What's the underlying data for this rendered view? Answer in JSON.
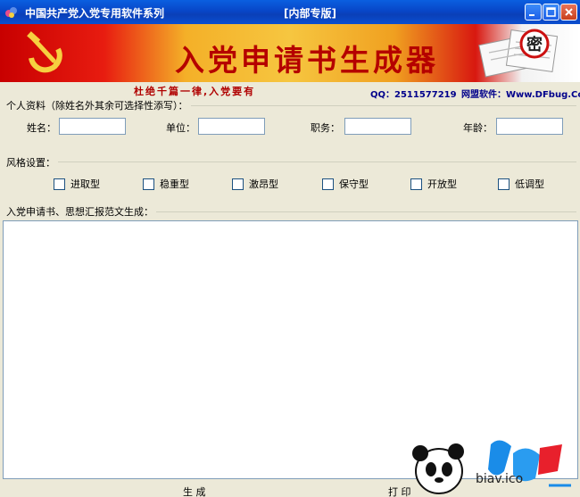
{
  "window": {
    "title": "中国共产党入党专用软件系列",
    "title_mid": "[内部专版]"
  },
  "banner": {
    "title": "入党申请书生成器",
    "stamp": "密"
  },
  "subheader": {
    "slogan": "杜绝千篇一律,入党要有",
    "qq": "QQ：2511577219",
    "web": "网盟软件：Www.DFbug.Com"
  },
  "personal": {
    "group_label": "个人资料（除姓名外其余可选择性添写）：",
    "name_label": "姓名：",
    "unit_label": "单位：",
    "position_label": "职务：",
    "age_label": "年龄：",
    "name_value": "",
    "unit_value": "",
    "position_value": "",
    "age_value": ""
  },
  "style": {
    "group_label": "风格设置：",
    "options": [
      "进取型",
      "稳重型",
      "激昂型",
      "保守型",
      "开放型",
      "低调型"
    ]
  },
  "output": {
    "group_label": "入党申请书、思想汇报范文生成：",
    "value": ""
  },
  "actions": {
    "generate_label": "生 成",
    "print_label": "打 印"
  },
  "watermark": {
    "text": "biav.ico"
  },
  "colors": {
    "titlebar": "#0846c8",
    "banner_red": "#c80000",
    "banner_title": "#b50000",
    "link_blue": "#00008b",
    "window_bg": "#ece9d8"
  }
}
